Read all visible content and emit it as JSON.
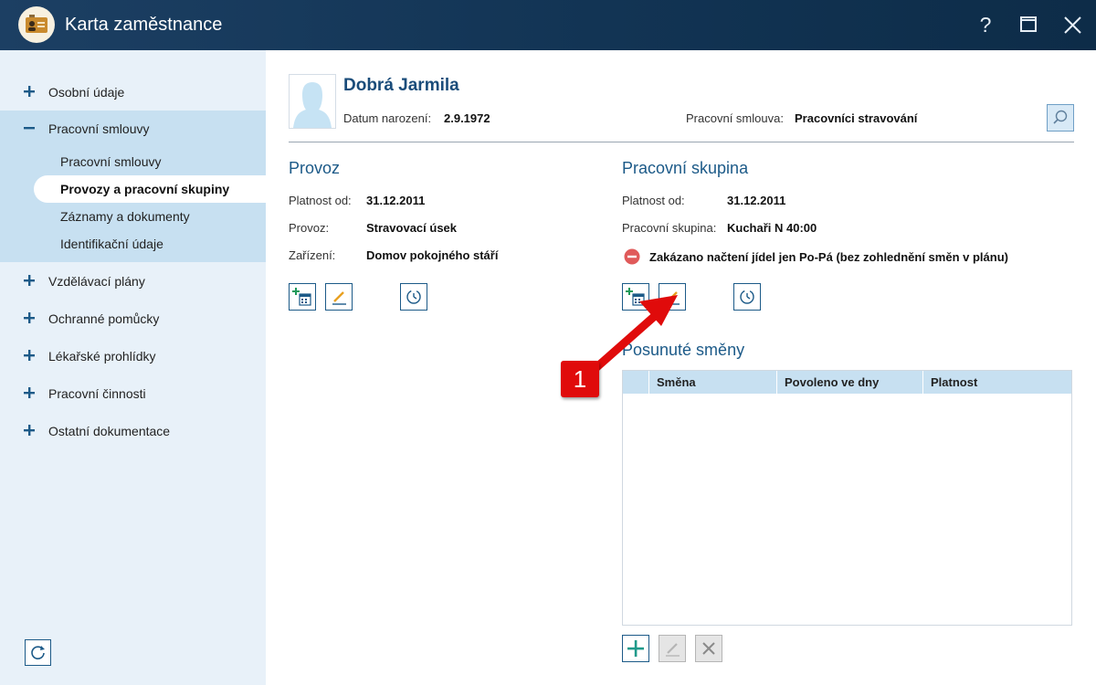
{
  "window": {
    "title": "Karta zaměstnance",
    "help_label": "?"
  },
  "sidebar": {
    "items_top": [
      {
        "label": "Osobní údaje",
        "state": "+"
      }
    ],
    "expanded": {
      "label": "Pracovní smlouvy",
      "state": "−"
    },
    "sub_items": [
      {
        "label": "Pracovní smlouvy"
      },
      {
        "label": "Provozy a pracovní skupiny",
        "active": true
      },
      {
        "label": "Záznamy a dokumenty"
      },
      {
        "label": "Identifikační údaje"
      }
    ],
    "items_bottom": [
      {
        "label": "Vzdělávací plány"
      },
      {
        "label": "Ochranné pomůcky"
      },
      {
        "label": "Lékařské prohlídky"
      },
      {
        "label": "Pracovní činnosti"
      },
      {
        "label": "Ostatní dokumentace"
      }
    ]
  },
  "employee": {
    "name": "Dobrá Jarmila",
    "dob_label": "Datum narození:",
    "dob_value": "2.9.1972",
    "contract_label": "Pracovní smlouva:",
    "contract_value": "Pracovníci stravování"
  },
  "provoz": {
    "title": "Provoz",
    "fields": [
      {
        "label": "Platnost od:",
        "value": "31.12.2011"
      },
      {
        "label": "Provoz:",
        "value": "Stravovací úsek"
      },
      {
        "label": "Zařízení:",
        "value": "Domov pokojného stáří"
      }
    ]
  },
  "skupina": {
    "title": "Pracovní skupina",
    "fields": [
      {
        "label": "Platnost od:",
        "value": "31.12.2011"
      },
      {
        "label": "Pracovní skupina:",
        "value": "Kuchaři N 40:00"
      }
    ],
    "warning": "Zakázano načtení jídel jen Po-Pá (bez zohlednění směn v plánu)"
  },
  "posunute": {
    "title": "Posunuté směny",
    "columns": [
      "Směna",
      "Povoleno ve dny",
      "Platnost"
    ]
  },
  "annotation": {
    "badge": "1"
  },
  "colors": {
    "accent": "#1c5a88",
    "titlebar": "#123454",
    "sidebar": "#e8f1f9",
    "sidebar_active": "#c7e0f1",
    "badge": "#e00b0b"
  }
}
